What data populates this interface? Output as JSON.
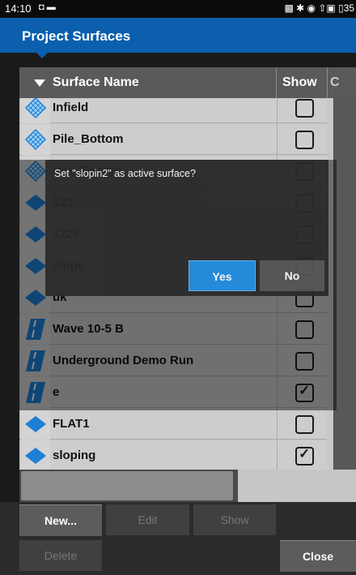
{
  "status": {
    "time": "14:10",
    "left_icons": "◘ ▬",
    "right_icons": "▩ ✱ ◉ ⇧▣ ▯35"
  },
  "title": "Project Surfaces",
  "table": {
    "headers": {
      "name": "Surface Name",
      "show": "Show",
      "extra": "C"
    },
    "rows": [
      {
        "name": "Infield",
        "icon": "diamond-grid-icon",
        "checked": false
      },
      {
        "name": "Pile_Bottom",
        "icon": "diamond-grid-icon",
        "checked": false
      },
      {
        "name": "Pile_Design",
        "icon": "diamond-grid-icon",
        "checked": false
      },
      {
        "name": "123",
        "icon": "blue-diamond-icon",
        "checked": false
      },
      {
        "name": "1229",
        "icon": "blue-diamond-icon",
        "checked": false
      },
      {
        "name": "slope",
        "icon": "blue-diamond-icon",
        "checked": false
      },
      {
        "name": "uk",
        "icon": "blue-diamond-icon",
        "checked": false
      },
      {
        "name": "Wave 10-5 B",
        "icon": "road-icon",
        "checked": false
      },
      {
        "name": "Underground Demo Run",
        "icon": "road-icon",
        "checked": false
      },
      {
        "name": "e",
        "icon": "road-icon",
        "checked": true
      },
      {
        "name": "FLAT1",
        "icon": "blue-diamond-icon",
        "checked": false
      },
      {
        "name": "sloping",
        "icon": "blue-diamond-icon",
        "checked": true
      }
    ]
  },
  "dialog": {
    "message": "Set \"slopin2\" as active surface?",
    "yes_label": "Yes",
    "no_label": "No"
  },
  "buttons": {
    "new": "New...",
    "edit": "Edit",
    "show": "Show",
    "delete": "Delete",
    "close": "Close"
  },
  "colors": {
    "title_bar": "#0b5fad",
    "icon_blue": "#1d7fd6",
    "yes_button": "#1f8ee3"
  }
}
